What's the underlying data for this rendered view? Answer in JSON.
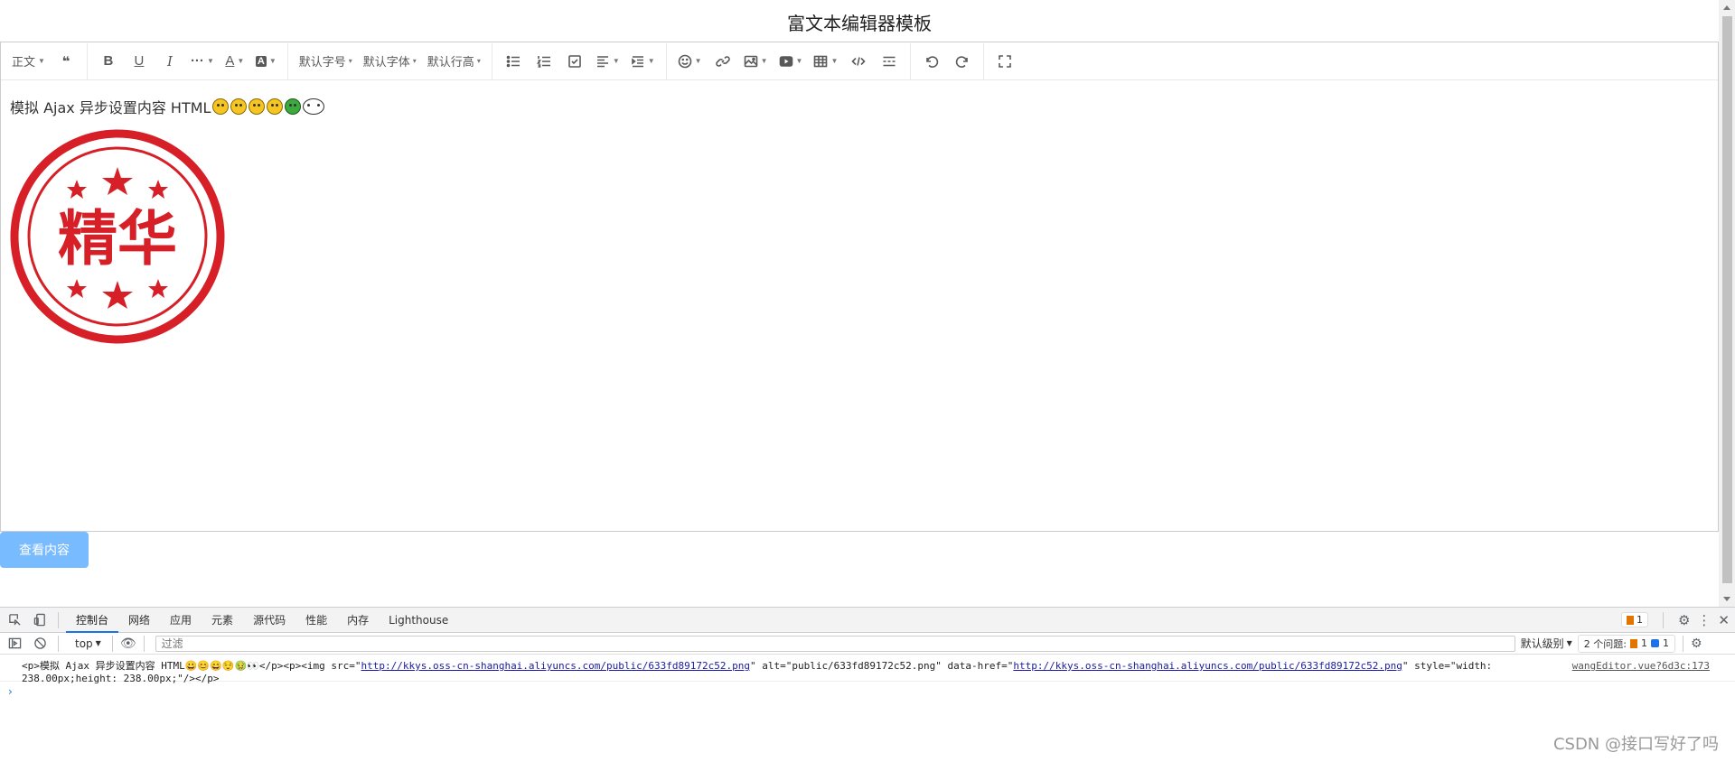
{
  "page": {
    "title": "富文本编辑器模板",
    "view_button": "查看内容"
  },
  "toolbar": {
    "paragraph": "正文",
    "font_size": "默认字号",
    "font_family": "默认字体",
    "line_height": "默认行高",
    "buttons": [
      "quote-icon",
      "bold-icon",
      "underline-icon",
      "italic-icon",
      "more-icon",
      "font-color-icon",
      "bg-color-icon",
      "bulleted-list-icon",
      "numbered-list-icon",
      "todo-icon",
      "align-icon",
      "indent-icon",
      "emotion-icon",
      "link-icon",
      "image-icon",
      "video-icon",
      "table-icon",
      "code-icon",
      "divider-icon",
      "undo-icon",
      "redo-icon",
      "fullscreen-icon"
    ]
  },
  "editor": {
    "text": "模拟 Ajax 异步设置内容 HTML",
    "emojis": [
      "grinning",
      "smiling",
      "grin",
      "relieved",
      "nauseated",
      "eyes"
    ],
    "stamp_text": "精华",
    "stamp_color": "#d61f26"
  },
  "devtools": {
    "tabs": [
      "控制台",
      "网络",
      "应用",
      "元素",
      "源代码",
      "性能",
      "内存",
      "Lighthouse"
    ],
    "active_tab": "控制台",
    "warn_count": "1",
    "context": "top",
    "filter_placeholder": "过滤",
    "level": "默认级别",
    "issues_label": "2 个问题:",
    "issues_warn": "1",
    "issues_info": "1",
    "console_message": {
      "prefix": "<p>模拟 Ajax 异步设置内容 HTML",
      "mid1": "</p><p><img src=\"",
      "url1": "http://kkys.oss-cn-shanghai.aliyuncs.com/public/633fd89172c52.png",
      "mid2": "\" alt=\"public/633fd89172c52.png\" data-href=\"",
      "url2": "http://kkys.oss-cn-shanghai.aliyuncs.com/public/633fd89172c52.png",
      "mid3": "\" style=\"width:",
      "line2": "238.00px;height: 238.00px;\"/></p>",
      "source": "wangEditor.vue?6d3c:173"
    }
  },
  "watermark": "CSDN @接口写好了吗"
}
